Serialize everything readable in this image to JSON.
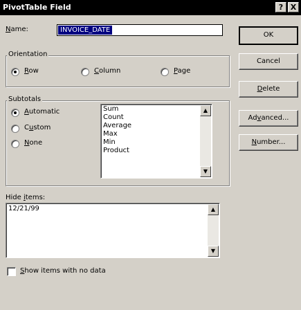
{
  "window": {
    "title": "PivotTable Field",
    "help_glyph": "?",
    "close_glyph": "X"
  },
  "name": {
    "label_prefix": "N",
    "label_rest": "ame:",
    "value": "INVOICE_DATE"
  },
  "buttons": {
    "ok": "OK",
    "cancel": "Cancel",
    "delete_u": "D",
    "delete_rest": "elete",
    "advanced_pre": "Ad",
    "advanced_u": "v",
    "advanced_rest": "anced...",
    "number_u": "N",
    "number_rest": "umber..."
  },
  "orientation": {
    "title": "Orientation",
    "options": [
      {
        "u": "R",
        "rest": "ow",
        "selected": true
      },
      {
        "u": "C",
        "rest": "olumn",
        "selected": false
      },
      {
        "u": "P",
        "rest": "age",
        "selected": false
      }
    ]
  },
  "subtotals": {
    "title": "Subtotals",
    "options": [
      {
        "u": "A",
        "rest": "utomatic",
        "selected": true
      },
      {
        "pre": "C",
        "u": "u",
        "rest": "stom",
        "selected": false
      },
      {
        "u": "N",
        "rest": "one",
        "selected": false
      }
    ],
    "functions": [
      "Sum",
      "Count",
      "Average",
      "Max",
      "Min",
      "Product"
    ]
  },
  "hide_items": {
    "label_pre": "Hide ",
    "label_u": "i",
    "label_rest": "tems:",
    "items": [
      "12/21/99"
    ]
  },
  "show_empty": {
    "u": "S",
    "rest": "how items with no data",
    "checked": false
  },
  "icons": {
    "scroll_up": "▲",
    "scroll_down": "▼"
  }
}
